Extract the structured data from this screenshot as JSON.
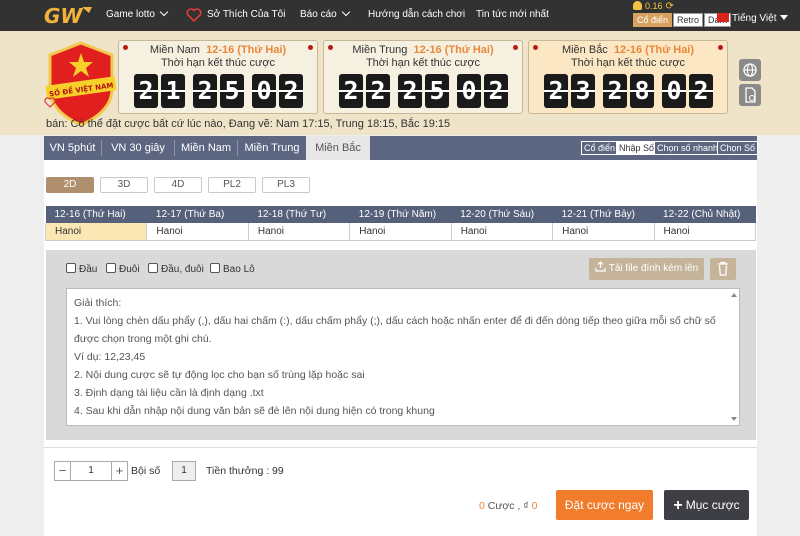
{
  "colors": {
    "accent": "#f07c2c",
    "nav_bg": "#323232",
    "tab_bar": "#5c6680",
    "header_bg": "#efe4c8",
    "highlight": "#fbe7b4"
  },
  "topbar": {
    "logo_text": "GW",
    "nav": [
      "Game lotto",
      "Sở Thích Của Tôi",
      "Báo cáo",
      "Hướng dẫn cách chơi",
      "Tin tức mới nhất"
    ],
    "balance": "0.16",
    "modes": [
      "Cổ điển",
      "Retro",
      "Dark"
    ],
    "active_mode": "Cổ điển",
    "language": "Tiếng Việt"
  },
  "badge": {
    "text": "SỐ ĐỀ VIỆT NAM"
  },
  "draws": [
    {
      "region": "Miền Nam",
      "date": "12-16 (Thứ Hai)",
      "subtitle": "Thời hạn kết thúc cược",
      "digits": [
        "2",
        "1",
        "2",
        "5",
        "0",
        "2"
      ]
    },
    {
      "region": "Miền Trung",
      "date": "12-16 (Thứ Hai)",
      "subtitle": "Thời hạn kết thúc cược",
      "digits": [
        "2",
        "2",
        "2",
        "5",
        "0",
        "2"
      ]
    },
    {
      "region": "Miền Bắc",
      "date": "12-16 (Thứ Hai)",
      "subtitle": "Thời hạn kết thúc cược",
      "digits": [
        "2",
        "3",
        "2",
        "8",
        "0",
        "2"
      ]
    }
  ],
  "notice": "bán: Có thể đặt cược bất cứ lúc nào,   Đang vẽ: Nam 17:15, Trung 18:15, Bắc 19:15",
  "region_tabs": [
    "VN 5phút",
    "VN 30 giây",
    "Miền Nam",
    "Miền Trung",
    "Miền Bắc"
  ],
  "active_region": "Miền Bắc",
  "input_modes": [
    "Cổ điển",
    "Nhập Số",
    "Chọn số nhanh",
    "Chọn Số"
  ],
  "active_input_mode": "Nhập Số",
  "bet_types": [
    "2D",
    "3D",
    "4D",
    "PL2",
    "PL3"
  ],
  "active_bet_type": "2D",
  "dates": [
    "12-16 (Thứ Hai)",
    "12-17 (Thứ Ba)",
    "12-18 (Thứ Tư)",
    "12-19 (Thứ Năm)",
    "12-20 (Thứ Sáu)",
    "12-21 (Thứ Bảy)",
    "12-22 (Chủ Nhật)"
  ],
  "date_values": [
    "Hanoi",
    "Hanoi",
    "Hanoi",
    "Hanoi",
    "Hanoi",
    "Hanoi",
    "Hanoi"
  ],
  "positions": [
    "Đầu",
    "Đuôi",
    "Đầu, đuôi",
    "Bao Lô"
  ],
  "upload_label": "Tải file đính kèm lên",
  "instructions": [
    "Giải thích:",
    "1. Vui lòng chèn dấu phẩy (,), dấu hai chấm (:), dấu chấm phẩy (;), dấu cách hoặc nhấn enter để đi đến dòng tiếp theo giữa mỗi số chữ số",
    "được chọn trong một ghi chú.",
    "Ví dụ: 12,23,45",
    "2. Nội dung cược sẽ tự động lọc cho bạn số trùng lặp hoặc sai",
    "3. Định dạng tài liệu cần là định dạng .txt",
    "4. Sau khi dẫn nhập nội dung văn bản sẽ đè lên nội dung hiện có trong khung"
  ],
  "stepper": {
    "minus": "−",
    "value": "1",
    "plus": "+"
  },
  "multiplier": {
    "label": "Bội số",
    "value": "1"
  },
  "prize": "Tiền thưởng : 99",
  "summary": {
    "count": "0",
    "count_label": "Cược ,",
    "amount_sym": "₫",
    "amount": "0"
  },
  "place_bet_label": "Đặt cược ngay",
  "cart_label": "Mục cược"
}
